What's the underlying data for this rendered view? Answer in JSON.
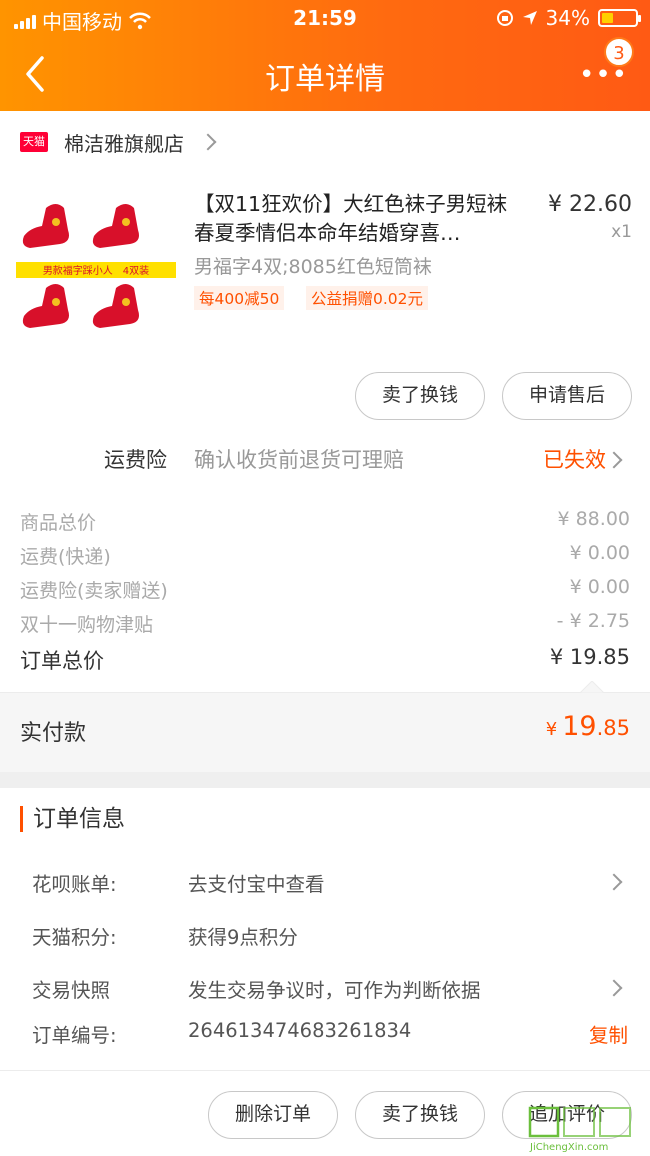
{
  "status_bar": {
    "carrier": "中国移动",
    "time": "21:59",
    "battery": "34%"
  },
  "nav": {
    "title": "订单详情",
    "badge": "3"
  },
  "shop": {
    "logo_text": "天猫",
    "name": "棉洁雅旗舰店"
  },
  "product": {
    "thumb_banner": "男款福字踩小人　4双装",
    "title": "【双11狂欢价】大红色袜子男短袜春夏季情侣本命年结婚穿喜…",
    "price": "¥ 22.60",
    "qty": "x1",
    "sku": "男福字4双;8085红色短筒袜",
    "tags": [
      "每400减50",
      "公益捐赠0.02元"
    ]
  },
  "product_actions": {
    "sell": "卖了换钱",
    "after_sale": "申请售后"
  },
  "insurance": {
    "label": "运费险",
    "desc": "确认收货前退货可理赔",
    "status": "已失效"
  },
  "price_lines": [
    {
      "label": "商品总价",
      "value": "¥ 88.00"
    },
    {
      "label": "运费(快递)",
      "value": "¥ 0.00"
    },
    {
      "label": "运费险(卖家赠送)",
      "value": "¥ 0.00"
    },
    {
      "label": "双十一购物津贴",
      "value": "- ¥ 2.75"
    }
  ],
  "order_total": {
    "label": "订单总价",
    "value": "¥ 19.85"
  },
  "paid": {
    "label": "实付款",
    "currency": "¥",
    "int": "19",
    "dec": ".85"
  },
  "order_info": {
    "title": "订单信息",
    "rows": [
      {
        "key": "花呗账单:",
        "value": "去支付宝中查看"
      },
      {
        "key": "天猫积分:",
        "value": "获得9点积分"
      },
      {
        "key": "交易快照",
        "value": "发生交易争议时，可作为判断依据"
      },
      {
        "key": "订单编号:",
        "value": "264613474683261834",
        "action": "复制"
      }
    ]
  },
  "bottom_actions": {
    "delete": "删除订单",
    "sell": "卖了换钱",
    "review": "追加评价"
  },
  "watermark": {
    "brand": "JiChengXin.com"
  },
  "colors": {
    "accent": "#ff5000",
    "header_start": "#ff9400",
    "header_end": "#ff5a14"
  }
}
